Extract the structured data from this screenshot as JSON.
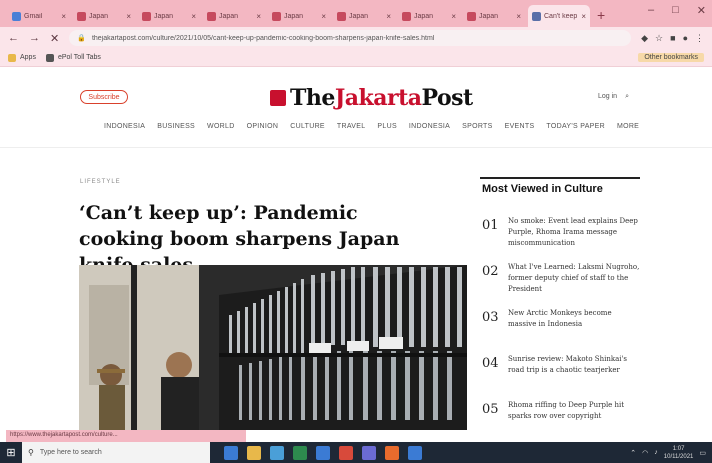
{
  "browser": {
    "tabs": [
      {
        "label": "Gmail",
        "color": "#4a7fd6"
      },
      {
        "label": "Japan",
        "color": "#c64a5e"
      },
      {
        "label": "Japan",
        "color": "#c64a5e"
      },
      {
        "label": "Japan",
        "color": "#c64a5e"
      },
      {
        "label": "Japan",
        "color": "#c64a5e"
      },
      {
        "label": "Japan",
        "color": "#c64a5e"
      },
      {
        "label": "Japan",
        "color": "#c64a5e"
      },
      {
        "label": "Japan",
        "color": "#c64a5e"
      },
      {
        "label": "Can't keep",
        "color": "#5a6fa8",
        "active": true
      }
    ],
    "new_tab": "+",
    "window_controls": [
      "–",
      "□",
      "✕"
    ],
    "address": "thejakartapost.com/culture/2021/10/05/cant-keep-up-pandemic-cooking-boom-sharpens-japan-knife-sales.html",
    "bookmarks": [
      "Apps",
      "ePol Toll Tabs"
    ],
    "bookmarks_right": "Other bookmarks",
    "status_link": "https://www.thejakartapost.com/culture..."
  },
  "site": {
    "subscribe": "Subscribe",
    "logo_a": "The",
    "logo_b": "Jakarta",
    "logo_c": "Post",
    "login": "Log in",
    "search_icon": "🔍",
    "nav": [
      "INDONESIA",
      "BUSINESS",
      "WORLD",
      "OPINION",
      "CULTURE",
      "TRAVEL",
      "PLUS",
      "INDONESIA",
      "SPORTS",
      "EVENTS",
      "TODAY'S PAPER",
      "MORE"
    ]
  },
  "article": {
    "kicker": "LIFESTYLE",
    "headline": "‘Can’t keep up’: Pandemic cooking boom sharpens Japan knife sales"
  },
  "most_viewed": {
    "title": "Most Viewed in Culture",
    "items": [
      {
        "num": "01",
        "text": "No smoke: Event lead explains Deep Purple, Rhoma Irama message miscommunication"
      },
      {
        "num": "02",
        "text": "What I've Learned: Laksmi Nugroho, former deputy chief of staff to the President"
      },
      {
        "num": "03",
        "text": "New Arctic Monkeys become massive in Indonesia"
      },
      {
        "num": "04",
        "text": "Sunrise review: Makoto Shinkai's road trip is a chaotic tearjerker"
      },
      {
        "num": "05",
        "text": "Rhoma riffing to Deep Purple hit sparks row over copyright"
      }
    ]
  },
  "taskbar": {
    "search_placeholder": "Type here to search",
    "time": "1:07",
    "date": "10/11/2021",
    "app_colors": [
      "#3b7bd4",
      "#e8b84a",
      "#4a9fd8",
      "#2d8a4e",
      "#3b7bd4",
      "#d84a3b",
      "#6b6bd4",
      "#e86b2d",
      "#3b7bd4"
    ]
  }
}
